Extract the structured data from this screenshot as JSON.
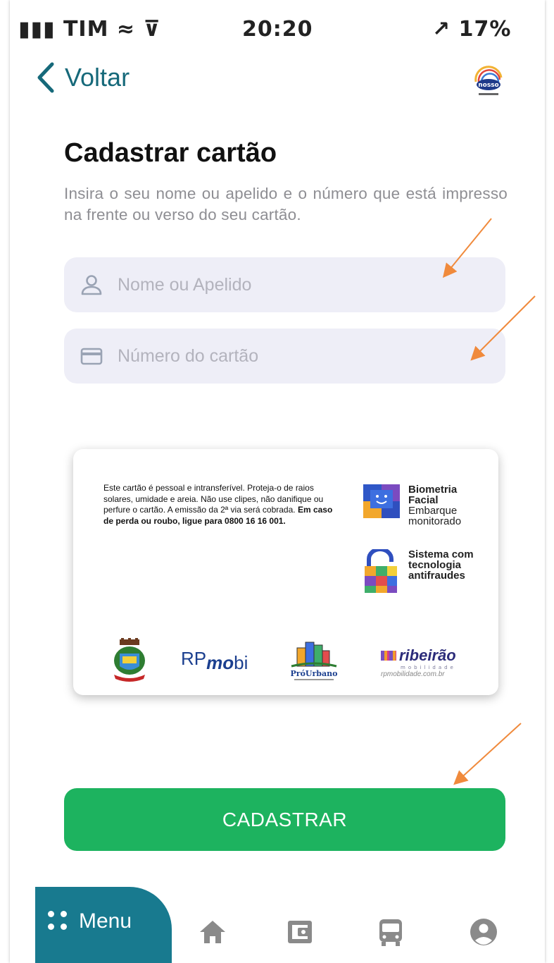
{
  "status_bar": {
    "left": "▮▮▮ TIM ≈ ⊽",
    "time": "20:20",
    "right": "↗ 17% ▭"
  },
  "header": {
    "back_label": "Voltar",
    "logo_icon": "nosso-mobilidade-logo"
  },
  "title": "Cadastrar cartão",
  "subtitle": "Insira o seu nome ou apelido e o número que está impresso na frente ou verso do seu cartão.",
  "form": {
    "name_field": {
      "placeholder": "Nome ou Apelido",
      "value": "",
      "icon": "user-icon"
    },
    "card_field": {
      "placeholder": "Número do cartão",
      "value": "",
      "icon": "credit-card-icon"
    }
  },
  "card_image": {
    "notice_part1": "Este cartão é pessoal e intransferível. Proteja-o de raios solares, umidade e areia. Não use clipes, não danifique ou perfure o cartão. A emissão da 2ª via será cobrada. ",
    "notice_bold": "Em caso de perda ou roubo, ligue para 0800 16 16 001.",
    "feature_biometry": {
      "title1": "Biometria",
      "title2": "Facial",
      "sub1": "Embarque",
      "sub2": "monitorado"
    },
    "feature_antifraud": {
      "line1": "Sistema com",
      "line2": "tecnologia",
      "line3": "antifraudes"
    },
    "partners": {
      "rp": "RP",
      "mo": "mo",
      "bi": "bi",
      "prourbano": "PróUrbano",
      "ribeirao": "ribeirão",
      "ribeirao_sub": "mobilidade",
      "ribeirao_url": "rpmobilidade.com.br"
    }
  },
  "submit": {
    "label": "CADASTRAR"
  },
  "bottom_nav": {
    "menu_label": "Menu",
    "items": [
      "home-icon",
      "wallet-icon",
      "bus-icon",
      "profile-icon"
    ]
  },
  "colors": {
    "accent": "#16697a",
    "button": "#1db35f",
    "menu_tab": "#187a8f",
    "field_bg": "#eeeef7",
    "annotation_arrow": "#f08a3c"
  }
}
